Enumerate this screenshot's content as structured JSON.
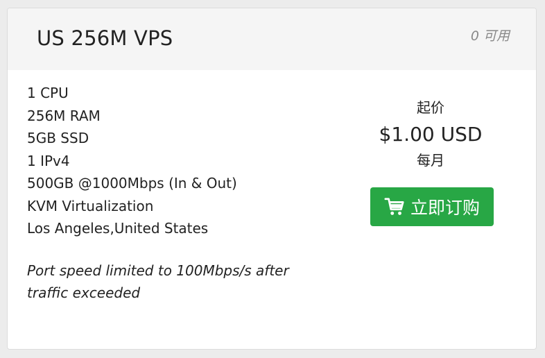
{
  "product": {
    "title": "US 256M VPS",
    "availability": "0 可用",
    "features": [
      "1 CPU",
      "256M RAM",
      "5GB SSD",
      "1 IPv4",
      "500GB @1000Mbps (In & Out)",
      "KVM Virtualization",
      "Los Angeles,United States"
    ],
    "note": "Port speed limited to 100Mbps/s after traffic exceeded"
  },
  "pricing": {
    "prefix": "起价",
    "amount": "$1.00 USD",
    "cycle": "每月"
  },
  "order_button": {
    "label": "立即订购",
    "icon": "shopping-cart-icon",
    "color": "#28a745"
  }
}
